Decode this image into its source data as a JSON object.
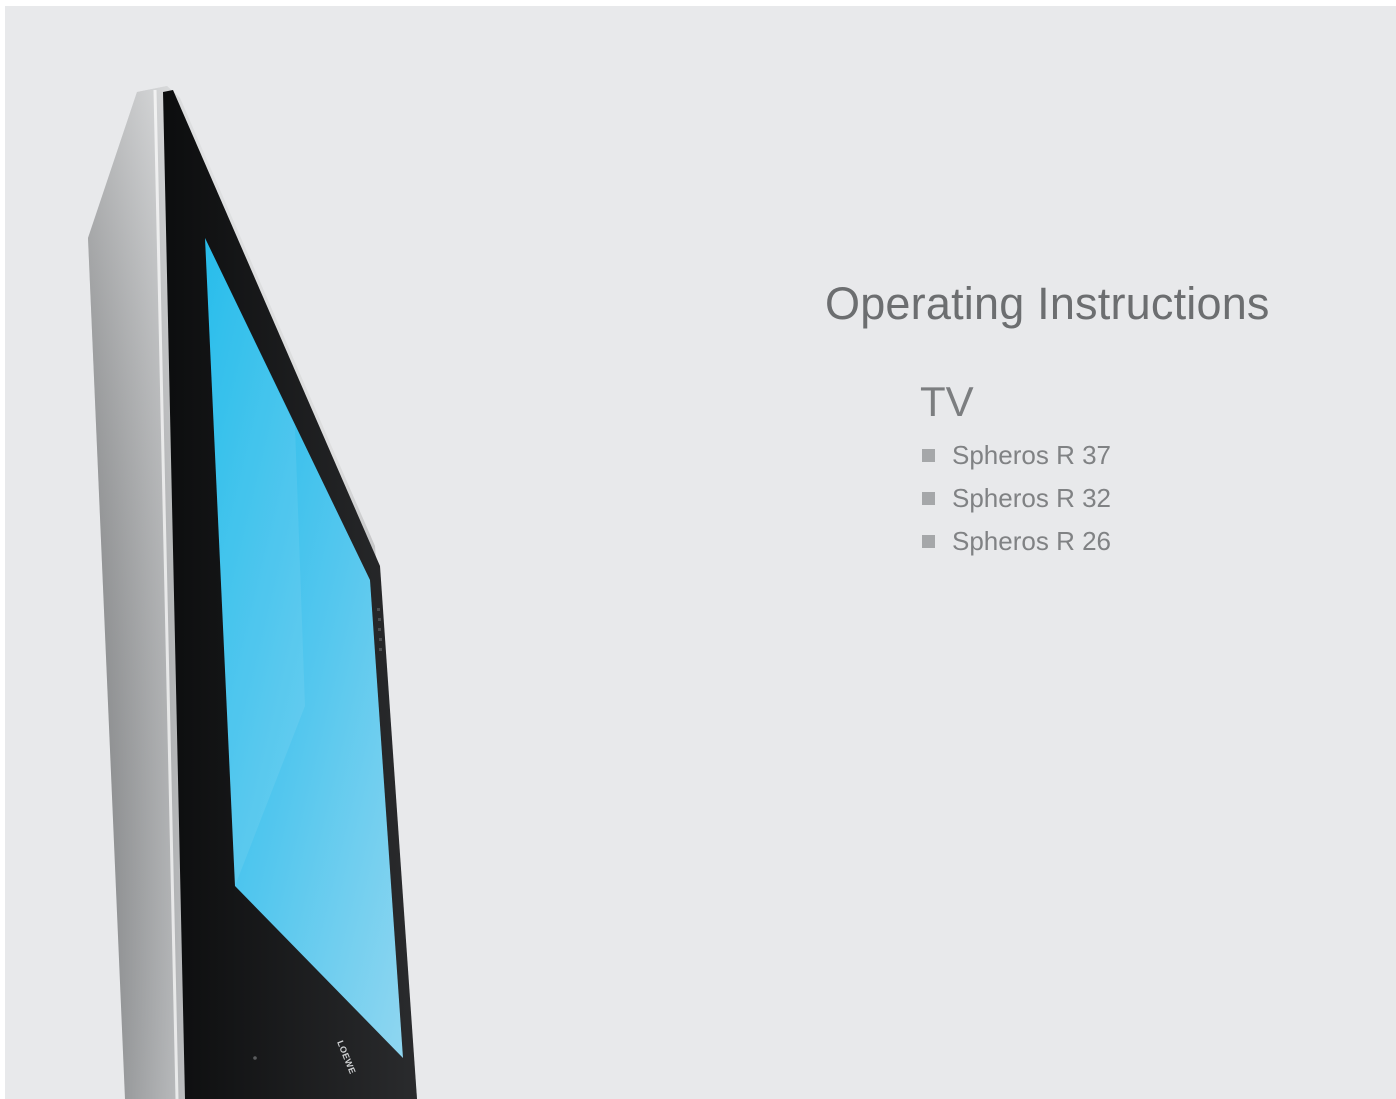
{
  "cover": {
    "title": "Operating Instructions",
    "category": "TV",
    "models": [
      {
        "label": "Spheros R 37"
      },
      {
        "label": "Spheros R 32"
      },
      {
        "label": "Spheros R 26"
      }
    ]
  },
  "image": {
    "subject": "flat-screen-tv",
    "logo_text": "LOEWE"
  },
  "colors": {
    "background": "#e8e9eb",
    "screen": "#5ec9ee",
    "bezel": "#1b1c1e",
    "frame": "#c9cbcd",
    "title_text": "#6c6e70",
    "bullet": "#a5a7a9"
  }
}
